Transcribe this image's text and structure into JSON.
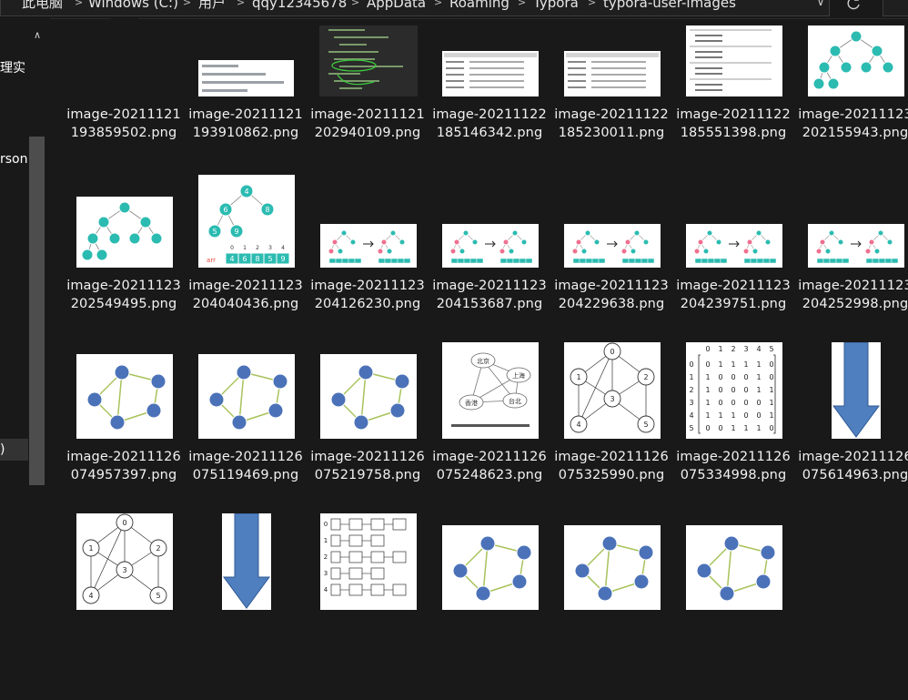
{
  "address": {
    "crumbs": [
      "此电脑",
      "Windows (C:)",
      "用户",
      "qqy12345678",
      "AppData",
      "Roaming",
      "Typora",
      "typora-user-images"
    ],
    "separator": ">",
    "dropdown_icon": "chevron-down-icon",
    "refresh_icon": "refresh-icon"
  },
  "nav": {
    "items": [
      "理实",
      "rson",
      ")"
    ],
    "up_icon": "chevron-up-icon"
  },
  "files": [
    {
      "name": "image-20211121193859502.png",
      "kind": "dash"
    },
    {
      "name": "image-20211121193910862.png",
      "kind": "form"
    },
    {
      "name": "image-20211121202940109.png",
      "kind": "code"
    },
    {
      "name": "image-20211122185146342.png",
      "kind": "table"
    },
    {
      "name": "image-20211122185230011.png",
      "kind": "table2"
    },
    {
      "name": "image-20211122185551398.png",
      "kind": "list"
    },
    {
      "name": "image-20211123202155943.png",
      "kind": "tree"
    },
    {
      "name": "image-20211123202549495.png",
      "kind": "tree"
    },
    {
      "name": "image-20211123204040436.png",
      "kind": "heap"
    },
    {
      "name": "image-20211123204126230.png",
      "kind": "pair"
    },
    {
      "name": "image-20211123204153687.png",
      "kind": "pair"
    },
    {
      "name": "image-20211123204229638.png",
      "kind": "pair"
    },
    {
      "name": "image-20211123204239751.png",
      "kind": "pair"
    },
    {
      "name": "image-20211123204252998.png",
      "kind": "pair"
    },
    {
      "name": "image-20211126074957397.png",
      "kind": "graph"
    },
    {
      "name": "image-20211126075119469.png",
      "kind": "graph"
    },
    {
      "name": "image-20211126075219758.png",
      "kind": "graph"
    },
    {
      "name": "image-20211126075248623.png",
      "kind": "map"
    },
    {
      "name": "image-20211126075325990.png",
      "kind": "ugraph"
    },
    {
      "name": "image-20211126075334998.png",
      "kind": "matrix"
    },
    {
      "name": "image-20211126075614963.png",
      "kind": "arrow"
    },
    {
      "name": "",
      "kind": "ugraph"
    },
    {
      "name": "",
      "kind": "arrow"
    },
    {
      "name": "",
      "kind": "adjlist"
    },
    {
      "name": "",
      "kind": "graph"
    },
    {
      "name": "",
      "kind": "graph"
    },
    {
      "name": "",
      "kind": "graph"
    }
  ],
  "thumb_texts": {
    "heap_array_label": "arr",
    "heap_values": [
      "4",
      "6",
      "8",
      "5",
      "9"
    ],
    "heap_indexes": [
      "0",
      "1",
      "2",
      "3",
      "4"
    ],
    "map_nodes": [
      "北京",
      "上海",
      "香港",
      "台北"
    ],
    "ugraph_nodes": [
      "0",
      "1",
      "2",
      "3",
      "4",
      "5"
    ],
    "matrix_header": [
      "0",
      "1",
      "2",
      "3",
      "4",
      "5"
    ],
    "matrix_rows": [
      [
        "0",
        "1",
        "1",
        "1",
        "1",
        "0"
      ],
      [
        "1",
        "0",
        "0",
        "0",
        "1",
        "0"
      ],
      [
        "1",
        "0",
        "0",
        "0",
        "1",
        "1"
      ],
      [
        "1",
        "0",
        "0",
        "0",
        "0",
        "1"
      ],
      [
        "1",
        "1",
        "1",
        "0",
        "0",
        "1"
      ],
      [
        "0",
        "0",
        "1",
        "1",
        "1",
        "0"
      ]
    ],
    "adj_rows": [
      "0",
      "1",
      "2",
      "3",
      "4"
    ]
  },
  "colors": {
    "background": "#191919",
    "teal": "#2bbbb1",
    "blue_node": "#4b72b8",
    "arrow_blue": "#4f7fbf",
    "pink": "#ef6f8e",
    "edge_green": "#a7c35b"
  }
}
